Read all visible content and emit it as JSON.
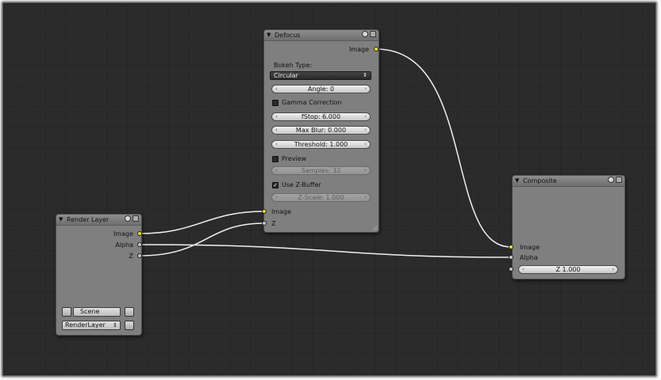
{
  "colors": {
    "canvas": "#2b2b2b",
    "node_body": "#7f7f7f",
    "socket_image": "#e6e620",
    "socket_value": "#c8c8c8",
    "wire": "#f0f0f0"
  },
  "nodes": {
    "defocus": {
      "title": "Defocus",
      "output_image_label": "Image",
      "bokeh_type_label": "Bokeh Type:",
      "bokeh_type_value": "Circular",
      "angle": "Angle: 0",
      "gamma_correction": "Gamma Correction",
      "fstop": "fStop: 6.000",
      "max_blur": "Max Blur: 0.000",
      "threshold": "Threshold: 1.000",
      "preview": "Preview",
      "samples": "Samples: 32",
      "use_zbuffer": "Use Z-Buffer",
      "z_scale": "Z-Scale: 1.000",
      "input_image_label": "Image",
      "input_z_label": "Z"
    },
    "render_layer": {
      "title": "Render Layer",
      "out_image": "Image",
      "out_alpha": "Alpha",
      "out_z": "Z",
      "scene": "Scene",
      "layer": "RenderLayer"
    },
    "composite": {
      "title": "Composite",
      "in_image": "Image",
      "in_alpha": "Alpha",
      "z_value": "Z 1.000"
    }
  },
  "icons": {
    "collapse": "triangle-down-icon",
    "node_options": "circle-icon",
    "scene_icon": "scene-icon",
    "dropdown": "up-down-caret-icon"
  }
}
